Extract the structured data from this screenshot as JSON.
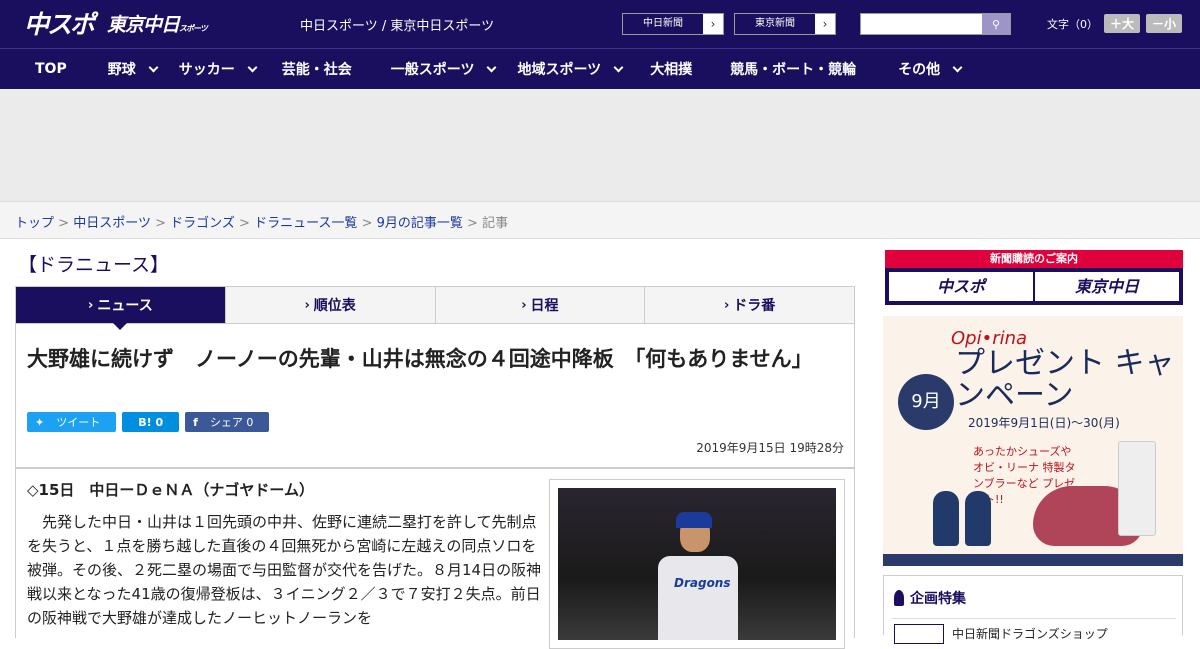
{
  "header": {
    "logo_main": "中スポ",
    "logo_sub": "東京中日",
    "logo_sub_small": "スポーツ",
    "site_names": "中日スポーツ / 東京中日スポーツ",
    "ext_links": [
      {
        "label": "中日新聞"
      },
      {
        "label": "東京新聞"
      }
    ],
    "search": {
      "placeholder": "",
      "icon": "search-icon"
    },
    "font_size": {
      "label": "文字（0）",
      "bigger": "＋大",
      "smaller": "－小"
    }
  },
  "nav": {
    "items": [
      {
        "label": "TOP",
        "has_dropdown": false
      },
      {
        "label": "野球",
        "has_dropdown": true
      },
      {
        "label": "サッカー",
        "has_dropdown": true
      },
      {
        "label": "芸能・社会",
        "has_dropdown": false
      },
      {
        "label": "一般スポーツ",
        "has_dropdown": true
      },
      {
        "label": "地域スポーツ",
        "has_dropdown": true
      },
      {
        "label": "大相撲",
        "has_dropdown": false
      },
      {
        "label": "競馬・ボート・競輪",
        "has_dropdown": false
      },
      {
        "label": "その他",
        "has_dropdown": true
      }
    ]
  },
  "breadcrumb": {
    "items": [
      "トップ",
      "中日スポーツ",
      "ドラゴンズ",
      "ドラニュース一覧",
      "9月の記事一覧"
    ],
    "current": "記事",
    "separator": ">"
  },
  "section_title": "【ドラニュース】",
  "tabs": [
    {
      "label": "ニュース",
      "active": true
    },
    {
      "label": "順位表",
      "active": false
    },
    {
      "label": "日程",
      "active": false
    },
    {
      "label": "ドラ番",
      "active": false
    }
  ],
  "article": {
    "title": "大野雄に続けず　ノーノーの先輩・山井は無念の４回途中降板　「何もありません」",
    "share": [
      {
        "label": "ツイート",
        "color": "#1da1f2"
      },
      {
        "label": "B! 0",
        "color": "#008fde"
      },
      {
        "label": "シェア 0",
        "color": "#3b5998"
      }
    ],
    "date": "2019年9月15日 19時28分",
    "subhead": "◇15日　中日ーＤｅＮＡ（ナゴヤドーム）",
    "body": "先発した中日・山井は１回先頭の中井、佐野に連続二塁打を許して先制点を失うと、１点を勝ち越した直後の４回無死から宮崎に左越えの同点ソロを被弾。その後、２死二塁の場面で与田監督が交代を告げた。８月14日の阪神戦以来となった41歳の復帰登板は、３イニング２／３で７安打２失点。前日の阪神戦で大野雄が達成したノーヒットノーランを",
    "photo_jersey": "Dragons"
  },
  "sidebar": {
    "subscribe": {
      "header": "新聞購読のご案内",
      "btn1": "中スポ",
      "btn2": "東京中日"
    },
    "banner": {
      "brand": "Opi•rina",
      "headline": "プレゼント キャンペーン",
      "month": "9月",
      "dates": "2019年9月1日(日)〜30(月)",
      "note": "あったかシューズや オビ・リーナ 特製タンブラーなど プレゼント!!"
    },
    "special": {
      "title": "企画特集",
      "item": "中日新聞ドラゴンズショップ"
    }
  },
  "colors": {
    "brand": "#1a0f5e",
    "accent": "#e0003c"
  }
}
